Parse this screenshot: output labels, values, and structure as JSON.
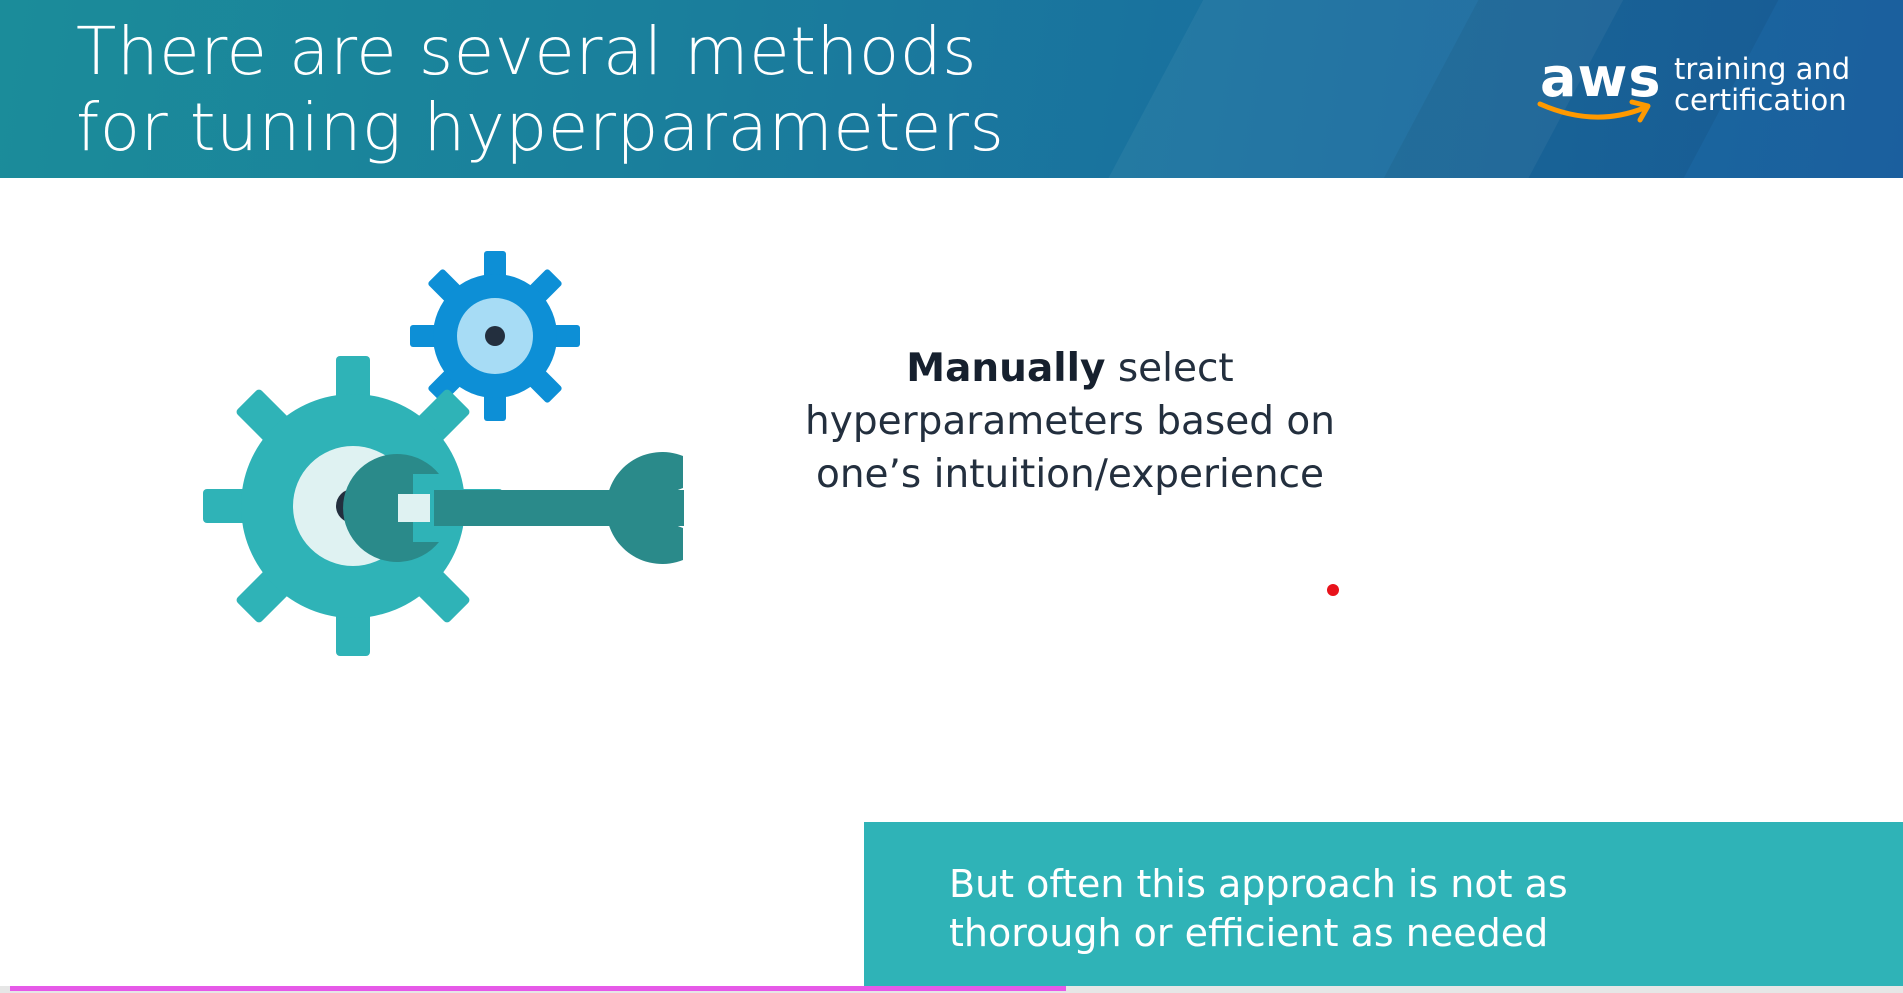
{
  "slide": {
    "title_lines": [
      "There are several methods",
      "for tuning hyperparameters"
    ],
    "logo": {
      "wordmark": "aws",
      "subtitle_lines": [
        "training and",
        "certification"
      ]
    },
    "main_text": {
      "bold": "Manually",
      "line1_rest": " select",
      "line2": "hyperparameters based on",
      "line3": "one’s intuition/experience"
    },
    "callout_lines": [
      "But often this approach is not as",
      "thorough or efficient as needed"
    ]
  },
  "player": {
    "progress_fraction": 0.555
  },
  "colors": {
    "header_teal": "#1b8c9a",
    "header_blue": "#1b5f9e",
    "gear_teal": "#2fb3b7",
    "gear_blue": "#0d8fd6",
    "wrench": "#2a8a8a",
    "callout_bg": "#2fb3b7",
    "text_dark": "#232f3e",
    "aws_orange": "#ff9900",
    "progress": "#e659e8",
    "pointer": "#e8121b"
  }
}
